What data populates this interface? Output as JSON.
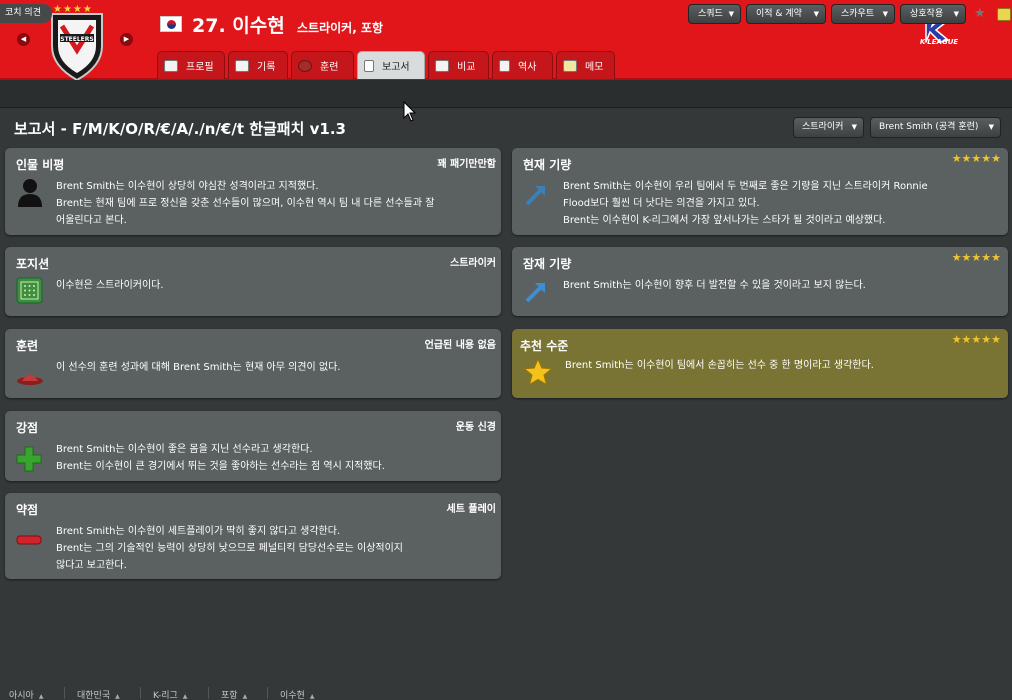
{
  "header": {
    "player_name": "27. 이수현",
    "player_position": "스트라이커, 포항",
    "club_stars": "★★★★",
    "league_name": "K-LEAGUE",
    "prev_arrow": "◀",
    "next_arrow": "▶",
    "tabs": [
      {
        "label": "프로필",
        "icon": "profile-icon"
      },
      {
        "label": "기록",
        "icon": "stats-icon"
      },
      {
        "label": "훈련",
        "icon": "training-icon"
      },
      {
        "label": "보고서",
        "icon": "report-icon",
        "active": true
      },
      {
        "label": "비교",
        "icon": "compare-icon"
      },
      {
        "label": "역사",
        "icon": "history-icon"
      },
      {
        "label": "메모",
        "icon": "notes-icon"
      }
    ]
  },
  "toolbar": {
    "coach_opinion": "코치 의견",
    "buttons": [
      {
        "label": "스쿼드"
      },
      {
        "label": "이적 & 계약"
      },
      {
        "label": "스카우트"
      },
      {
        "label": "상호작용"
      }
    ],
    "caret": "▼",
    "star": "★"
  },
  "page": {
    "title": "보고서 - F/M/K/O/R/€/A/./n/€/t 한글패치 v1.3",
    "dropdowns": [
      {
        "label": "스트라이커"
      },
      {
        "label": "Brent Smith (공격 훈련)"
      }
    ]
  },
  "left_cards": [
    {
      "title": "인물 비평",
      "tag": "꽤 패기만만함",
      "icon": "person-silhouette-icon",
      "lines": [
        "Brent Smith는 이수현이 상당히 야심찬 성격이라고 지적했다.",
        "Brent는 현재 팀에 프로 정신을 갖춘 선수들이 많으며, 이수현 역시 팀 내 다른 선수들과 잘",
        "어울린다고 본다."
      ]
    },
    {
      "title": "포지션",
      "tag": "스트라이커",
      "icon": "pitch-icon",
      "lines": [
        "이수현은 스트라이커이다."
      ]
    },
    {
      "title": "훈련",
      "tag": "언급된 내용 없음",
      "icon": "training-cone-icon",
      "lines": [
        "이 선수의 훈련 성과에 대해 Brent Smith는 현재 아무 의견이 없다."
      ]
    },
    {
      "title": "강점",
      "tag": "운동 신경",
      "icon": "plus-icon",
      "lines": [
        "Brent Smith는 이수현이 좋은 몸을 지닌 선수라고 생각한다.",
        "Brent는 이수현이 큰 경기에서 뛰는 것을 좋아하는 선수라는 점 역시 지적했다."
      ]
    },
    {
      "title": "약점",
      "tag": "세트 플레이",
      "icon": "minus-icon",
      "lines": [
        "Brent Smith는 이수현이 세트플레이가 딱히 좋지 않다고 생각한다.",
        "Brent는 그의 기술적인 능력이 상당히 낮으므로 페널티킥 담당선수로는 이상적이지",
        "않다고 보고한다."
      ]
    }
  ],
  "right_cards": [
    {
      "title": "현재 기량",
      "stars": "★★★★★",
      "rating": 5,
      "icon": "current-ability-arrow-icon",
      "lines": [
        "Brent Smith는 이수현이 우리 팀에서 두 번째로 좋은 기량을 지닌 스트라이커 Ronnie",
        "Flood보다 훨씬 더 낫다는 의견을 가지고 있다.",
        "Brent는 이수현이 K-리그에서 가장 앞서나가는 스타가 될 것이라고 예상했다."
      ]
    },
    {
      "title": "잠재 기량",
      "stars": "★★★★★",
      "rating": 5,
      "icon": "potential-ability-arrow-icon",
      "lines": [
        "Brent Smith는 이수현이 향후 더 발전할 수 있을 것이라고 보지 않는다."
      ]
    },
    {
      "title": "추천 수준",
      "stars": "★★★★★",
      "rating": 5,
      "icon": "star-icon",
      "lines": [
        "Brent Smith는 이수현이 팀에서 손꼽히는 선수 중 한 명이라고 생각한다."
      ]
    }
  ],
  "breadcrumbs": [
    "아시아",
    "대한민국",
    "K-리그",
    "포항",
    "이수현"
  ],
  "crumb_arrow": "▲"
}
